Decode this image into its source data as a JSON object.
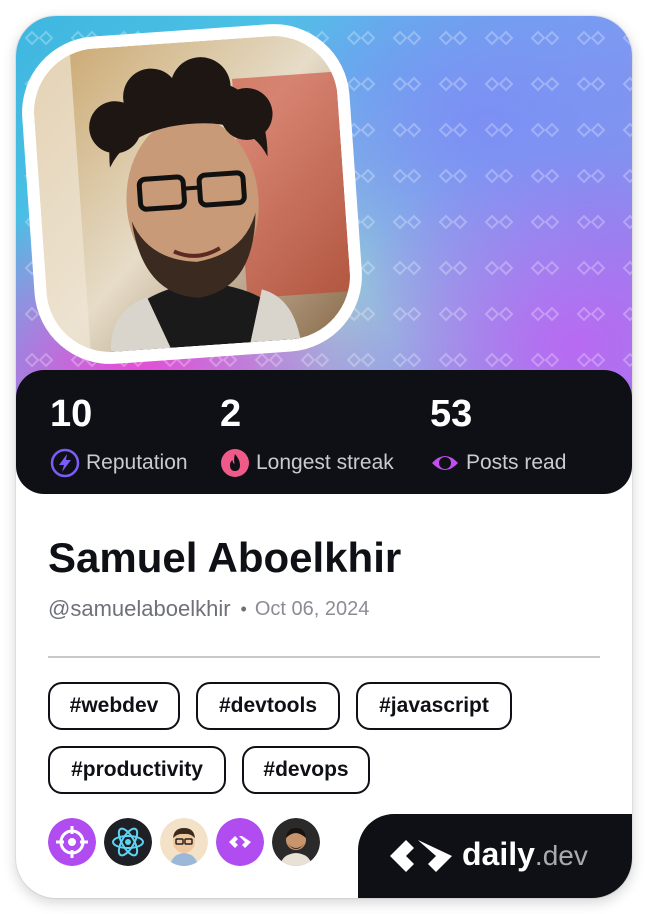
{
  "profile": {
    "name": "Samuel Aboelkhir",
    "handle": "@samuelaboelkhir",
    "separator": "•",
    "joined": "Oct 06, 2024",
    "avatar_icon": "profile-photo"
  },
  "stats": [
    {
      "value": "10",
      "label": "Reputation",
      "icon": "lightning-icon",
      "color": "#7b5cf5"
    },
    {
      "value": "2",
      "label": "Longest streak",
      "icon": "flame-icon",
      "color": "#f05a88"
    },
    {
      "value": "53",
      "label": "Posts read",
      "icon": "eye-ring-icon",
      "color": "#c24ef0"
    }
  ],
  "tags": [
    "#webdev",
    "#devtools",
    "#javascript",
    "#productivity",
    "#devops"
  ],
  "squads": [
    {
      "icon": "crosshair-icon",
      "color": "#b04cf0"
    },
    {
      "icon": "react-atom-icon",
      "color": "#1e2026"
    },
    {
      "icon": "memoji-avatar",
      "color": "#f4e2c8"
    },
    {
      "icon": "daily-dev-logo-icon",
      "color": "#b04cf0"
    },
    {
      "icon": "member-avatar",
      "color": "#2a2a2a"
    }
  ],
  "brand": {
    "name": "daily",
    "suffix": ".dev",
    "icon": "daily-dev-logo-icon"
  },
  "colors": {
    "card_dark": "#0e1015",
    "text_dark": "#0e1015",
    "muted": "#6f717a"
  }
}
